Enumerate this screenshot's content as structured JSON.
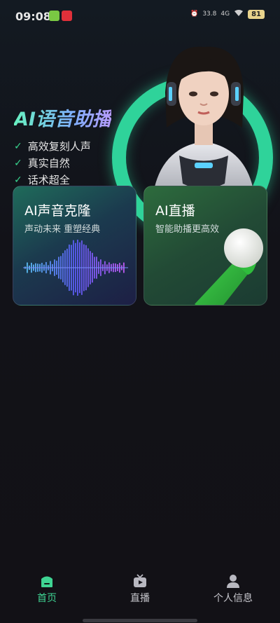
{
  "status_bar": {
    "time": "09:08",
    "network_speed": "33.8",
    "signal": "4G",
    "battery": "81"
  },
  "hero": {
    "title": "AI语音助播",
    "features": [
      "高效复刻人声",
      "真实自然",
      "话术超全"
    ]
  },
  "cards": [
    {
      "title": "AI声音克隆",
      "subtitle": "声动未来 重塑经典"
    },
    {
      "title": "AI直播",
      "subtitle": "智能助播更高效"
    }
  ],
  "tabbar": {
    "items": [
      {
        "label": "首页",
        "icon": "home-icon",
        "active": true
      },
      {
        "label": "直播",
        "icon": "tv-icon",
        "active": false
      },
      {
        "label": "个人信息",
        "icon": "person-icon",
        "active": false
      }
    ]
  },
  "colors": {
    "accent": "#3fd493",
    "ring": "#2fd39a"
  }
}
